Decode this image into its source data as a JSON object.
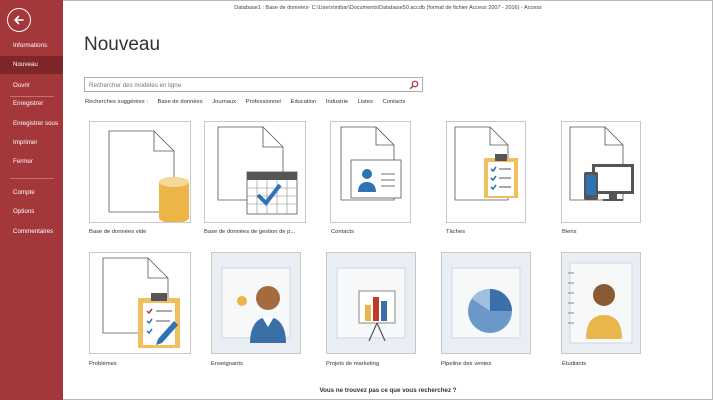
{
  "titlebar": "Database1 : Base de données- C:\\Users\\mibar\\Documents\\Database50.accdb (format de fichier Access 2007 - 2016)  -  Access",
  "sidebar": {
    "items": [
      {
        "label": "Informations"
      },
      {
        "label": "Nouveau",
        "active": true
      },
      {
        "label": "Ouvrir"
      },
      {
        "label": "Enregistrer"
      },
      {
        "label": "Enregistrer sous"
      },
      {
        "label": "Imprimer"
      },
      {
        "label": "Fermer"
      },
      {
        "label": "Compte"
      },
      {
        "label": "Options"
      },
      {
        "label": "Commentaires"
      }
    ]
  },
  "page": {
    "title": "Nouveau",
    "search_placeholder": "Rechercher des modèles en ligne"
  },
  "suggestions": {
    "label": "Recherches suggérées :",
    "links": [
      "Base de données",
      "Journaux",
      "Professionnel",
      "Éducation",
      "Industrie",
      "Listes",
      "Contacts"
    ]
  },
  "templates": [
    {
      "label": "Base de données vide",
      "icon": "blank-database-icon"
    },
    {
      "label": "Base de données de gestion de p...",
      "icon": "calendar-database-icon"
    },
    {
      "label": "Contacts",
      "icon": "contacts-icon"
    },
    {
      "label": "Tâches",
      "icon": "tasks-icon"
    },
    {
      "label": "Biens",
      "icon": "assets-icon"
    },
    {
      "label": "Problèmes",
      "icon": "issues-icon"
    },
    {
      "label": "Enseignants",
      "icon": "faculty-icon"
    },
    {
      "label": "Projets de marketing",
      "icon": "marketing-projects-icon"
    },
    {
      "label": "Pipeline des ventes",
      "icon": "sales-pipeline-icon"
    },
    {
      "label": "Étudiants",
      "icon": "students-icon"
    }
  ],
  "footer": {
    "question": "Vous ne trouvez pas ce que vous recherchez ?"
  },
  "colors": {
    "sidebar": "#a4373a",
    "sidebar_active": "#7f2628",
    "accent_yellow": "#f0c060",
    "accent_blue": "#3a6fa8"
  }
}
